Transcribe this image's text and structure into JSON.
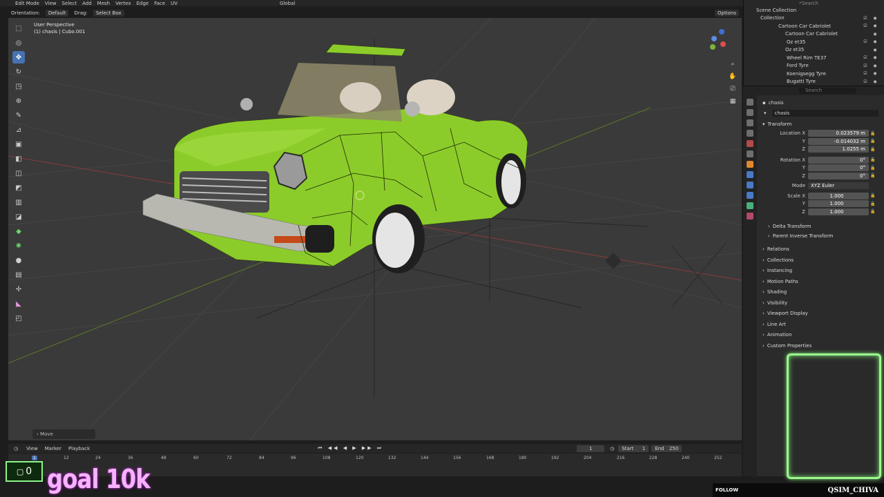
{
  "header": {
    "mode": "Edit Mode",
    "menus": [
      "View",
      "Select",
      "Add",
      "Mesh",
      "Vertex",
      "Edge",
      "Face",
      "UV"
    ],
    "transform_space": "Global",
    "options_label": "Options"
  },
  "tool_header": {
    "orientation_label": "Orientation:",
    "orientation_value": "Default",
    "drag_label": "Drag:",
    "drag_value": "Select Box"
  },
  "viewport": {
    "view_name": "User Perspective",
    "object_info": "(1) chasis | Cubo.001",
    "last_op": "Move"
  },
  "outliner": {
    "search_placeholder": "Search",
    "rows": [
      {
        "label": "Scene Collection"
      },
      {
        "label": "Collection"
      },
      {
        "label": "Cartoon Car Cabriolet"
      },
      {
        "label": "Cartoon Car Cabriolet"
      },
      {
        "label": "Oz et35"
      },
      {
        "label": "Oz et35"
      },
      {
        "label": "Wheel Rim TE37"
      },
      {
        "label": "Ford Tyre"
      },
      {
        "label": "Koenigsegg Tyre"
      },
      {
        "label": "Bugatti Tyre"
      }
    ]
  },
  "properties": {
    "search_placeholder": "Search",
    "object_name": "chasis",
    "object_field": "chasis",
    "transform_title": "Transform",
    "location": {
      "x_label": "Location X",
      "x": "0.023579 m",
      "y": "-0.014032 m",
      "z": "1.0255 m"
    },
    "rotation": {
      "x_label": "Rotation X",
      "x": "0°",
      "y": "0°",
      "z": "0°"
    },
    "mode_label": "Mode",
    "mode_value": "XYZ Euler",
    "scale": {
      "x_label": "Scale X",
      "x": "1.000",
      "y": "1.000",
      "z": "1.000"
    },
    "axis_y": "Y",
    "axis_z": "Z",
    "subpanels": [
      "Delta Transform",
      "Parent Inverse Transform"
    ],
    "panels": [
      "Relations",
      "Collections",
      "Instancing",
      "Motion Paths",
      "Shading",
      "Visibility",
      "Viewport Display",
      "Line Art",
      "Animation",
      "Custom Properties"
    ]
  },
  "timeline": {
    "menus": [
      "View",
      "Marker",
      "Playback"
    ],
    "current_frame": "1",
    "start_label": "Start",
    "start": "1",
    "end_label": "End",
    "end": "250",
    "ticks": [
      "1",
      "12",
      "24",
      "36",
      "48",
      "60",
      "72",
      "84",
      "96",
      "108",
      "120",
      "132",
      "144",
      "156",
      "168",
      "180",
      "192",
      "204",
      "216",
      "228",
      "240",
      "252"
    ]
  },
  "overlay": {
    "counter": "0",
    "goal": "goal 10k",
    "follow": "FOLLOW",
    "handle": "QSIM_CHIVA"
  },
  "colors": {
    "accent": "#4772b3",
    "car_body": "#8ccc2a",
    "goal_text": "#f6b3ff",
    "frame_green": "#9cf88f"
  }
}
